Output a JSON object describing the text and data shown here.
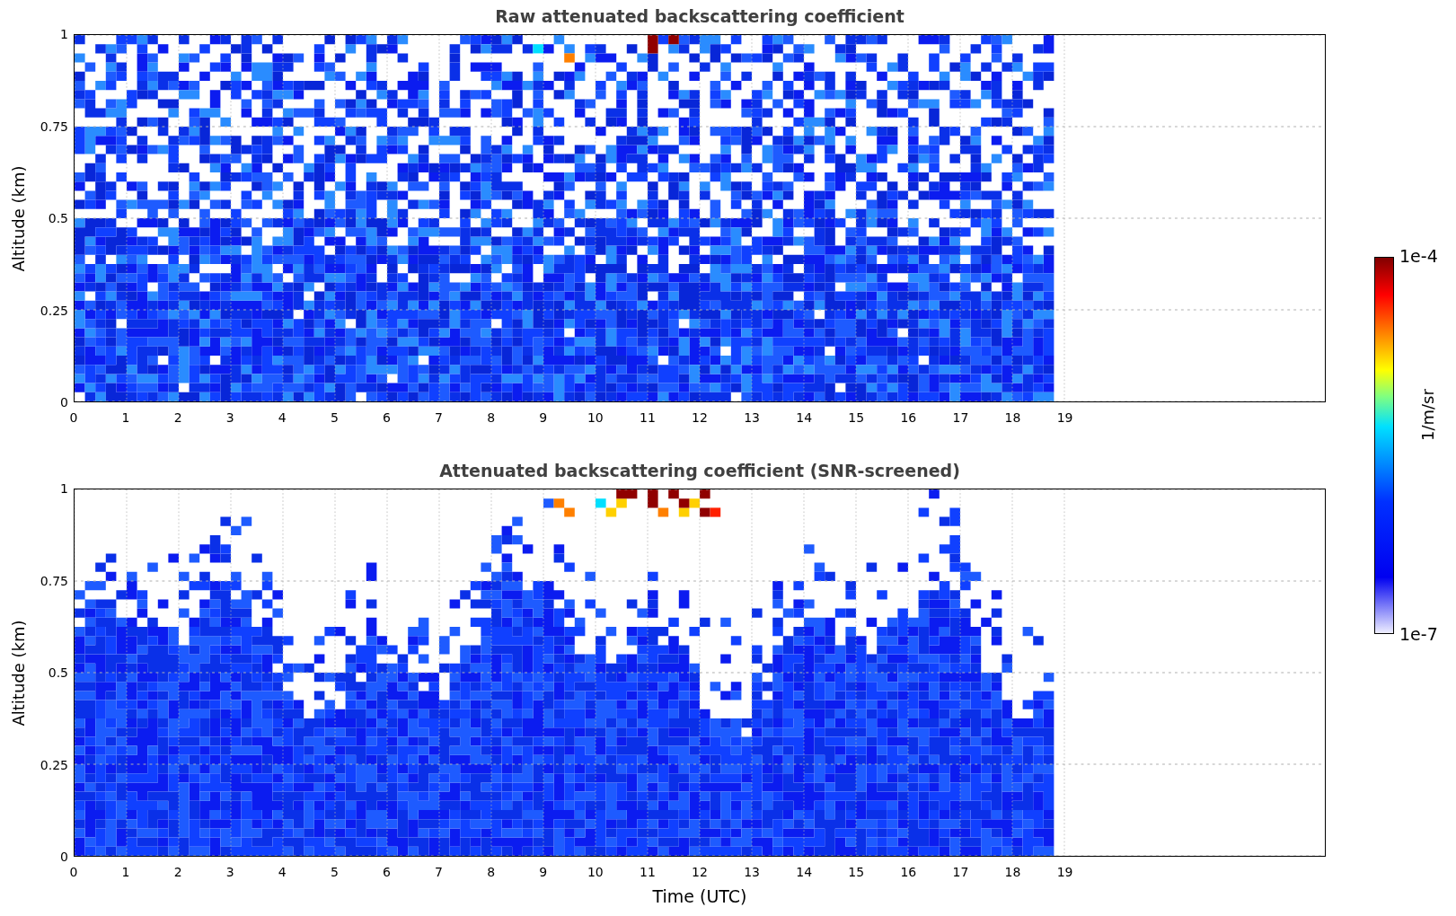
{
  "panels": [
    {
      "kind": "raw",
      "title": "Raw attenuated backscattering coefficient",
      "ylabel": "Altitude (km)",
      "yticks": [
        "1",
        "0.75",
        "0.5",
        "0.25",
        "0"
      ],
      "xticks": [
        "0",
        "1",
        "2",
        "3",
        "4",
        "5",
        "6",
        "7",
        "8",
        "9",
        "10",
        "11",
        "12",
        "13",
        "14",
        "15",
        "16",
        "17",
        "18",
        "19"
      ]
    },
    {
      "kind": "screened",
      "title": "Attenuated backscattering coefficient (SNR-screened)",
      "ylabel": "Altitude (km)",
      "yticks": [
        "1",
        "0.75",
        "0.5",
        "0.25",
        "0"
      ],
      "xticks": [
        "0",
        "1",
        "2",
        "3",
        "4",
        "5",
        "6",
        "7",
        "8",
        "9",
        "10",
        "11",
        "12",
        "13",
        "14",
        "15",
        "16",
        "17",
        "18",
        "19"
      ],
      "xlabel": "Time (UTC)"
    }
  ],
  "colorbar": {
    "max": "1e-4",
    "min": "1e-7",
    "label": "1/m/sr"
  }
}
